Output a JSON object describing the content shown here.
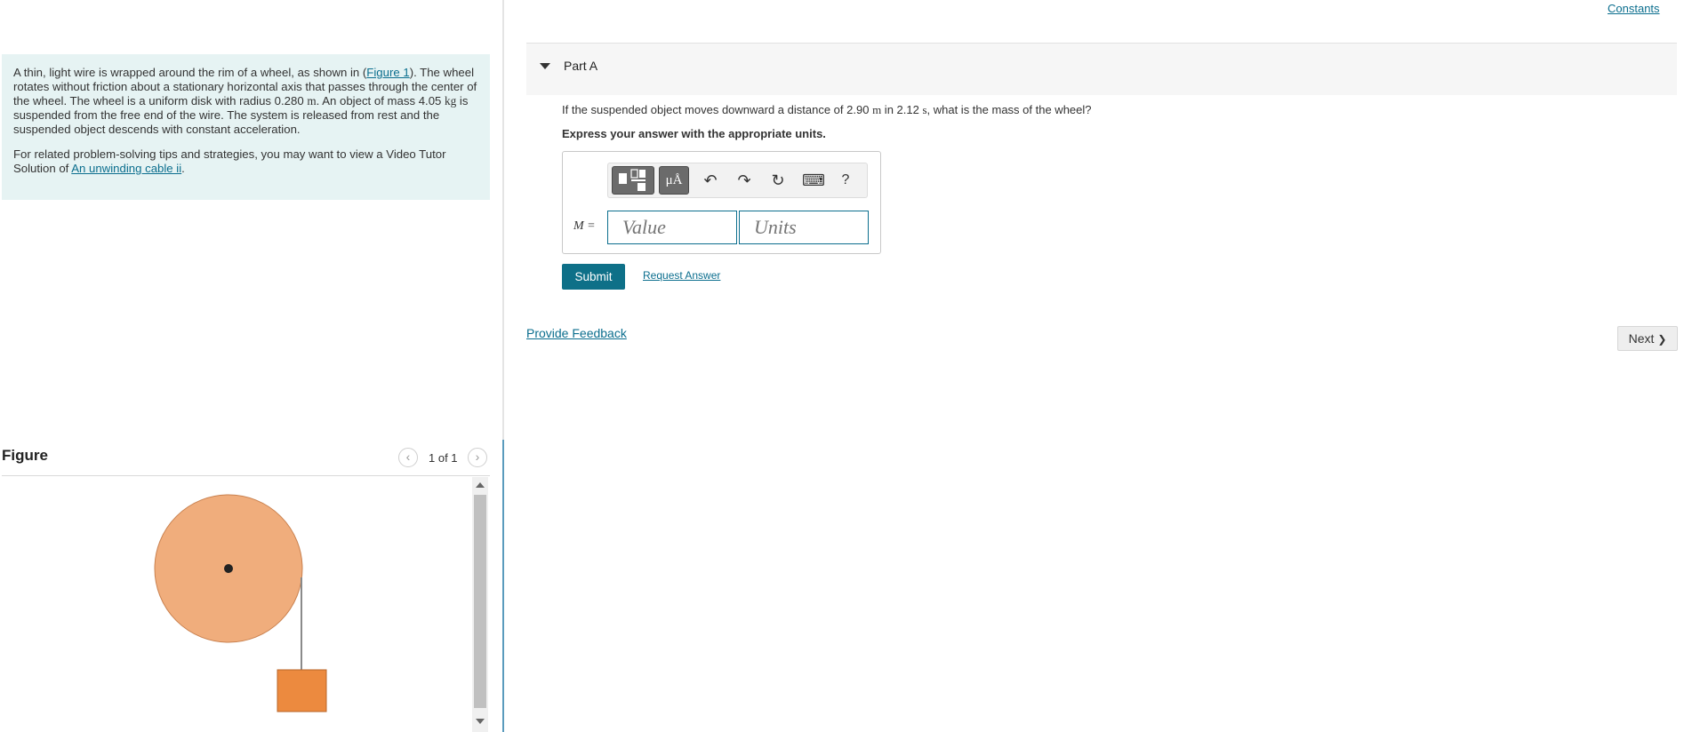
{
  "problem": {
    "paragraph1": {
      "part1": "A thin, light wire is wrapped around the rim of a wheel, as shown in (",
      "figure_link": "Figure 1",
      "part2": "). The wheel rotates without friction about a stationary horizontal axis that passes through the center of the wheel. The wheel is a uniform disk with radius 0.280 ",
      "unit_m": "m",
      "part3": ". An object of mass 4.05 ",
      "unit_kg": "kg",
      "part4": " is suspended from the free end of the wire. The system is released from rest and the suspended object descends with constant acceleration."
    },
    "paragraph2": {
      "text": "For related problem-solving tips and strategies, you may want to view a Video Tutor Solution of ",
      "link": "An unwinding cable ii",
      "end": "."
    }
  },
  "figure": {
    "title": "Figure",
    "pager_text": "1 of 1",
    "prev_icon": "‹",
    "next_icon": "›",
    "colors": {
      "wheel": "#f0ad7c",
      "block": "#ec8a3f",
      "wire": "#8a8a8a"
    }
  },
  "header": {
    "constants_link": "Constants"
  },
  "part": {
    "title": "Part A",
    "question": {
      "part1": "If the suspended object moves downward a distance of 2.90 ",
      "unit_m": "m",
      "part2": " in 2.12 ",
      "unit_s": "s",
      "part3": ", what is the mass of the wheel?"
    },
    "instruction": "Express your answer with the appropriate units."
  },
  "answer": {
    "variable_label": "M =",
    "value_placeholder": "Value",
    "units_placeholder": "Units",
    "toolbar": {
      "units_label": "μÅ",
      "undo": "↶",
      "redo": "↷",
      "reset": "↻",
      "keyboard": "⌨",
      "help": "?"
    }
  },
  "actions": {
    "submit": "Submit",
    "request_answer": "Request Answer",
    "feedback": "Provide Feedback",
    "next": "Next",
    "next_icon": "❯"
  }
}
